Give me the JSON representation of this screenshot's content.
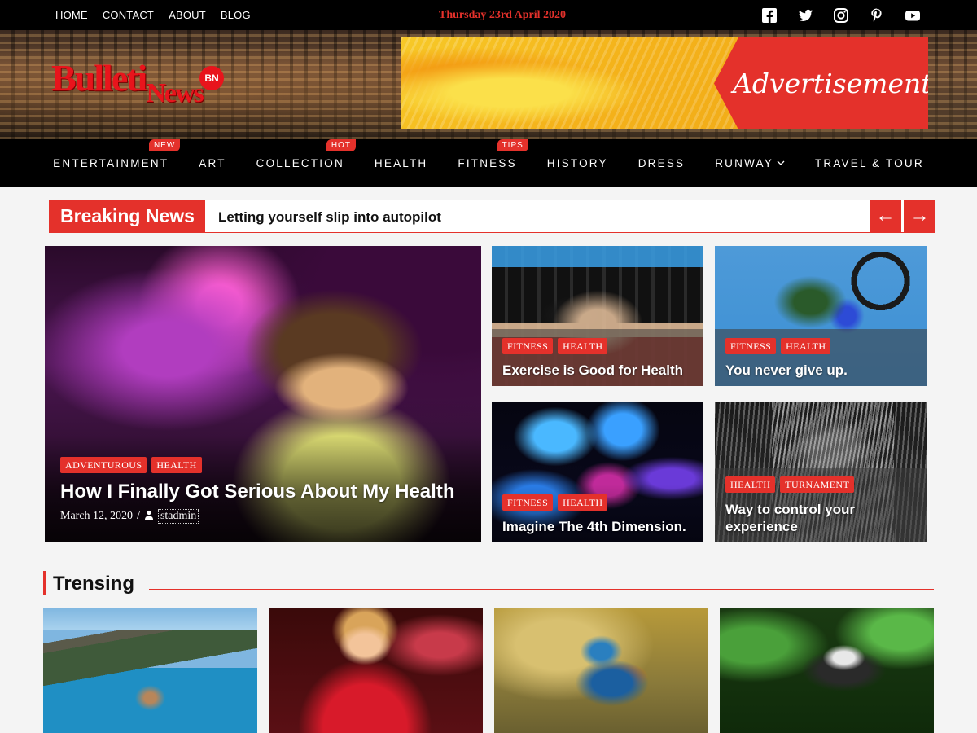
{
  "colors": {
    "accent": "#e4312b",
    "topbar": "#000000"
  },
  "topbar": {
    "links": [
      "HOME",
      "CONTACT",
      "ABOUT",
      "BLOG"
    ],
    "date": "Thursday 23rd April 2020",
    "socials": [
      "facebook-icon",
      "twitter-icon",
      "instagram-icon",
      "pinterest-icon",
      "youtube-icon"
    ]
  },
  "header": {
    "logo": {
      "word1": "Bulleti",
      "word2": "News",
      "badge": "BN"
    },
    "ad_text": "Advertisement"
  },
  "nav": {
    "items": [
      {
        "label": "ENTERTAINMENT",
        "badge": "NEW"
      },
      {
        "label": "ART"
      },
      {
        "label": "COLLECTION",
        "badge": "HOT"
      },
      {
        "label": "HEALTH"
      },
      {
        "label": "FITNESS",
        "badge": "TIPS"
      },
      {
        "label": "HISTORY"
      },
      {
        "label": "DRESS"
      },
      {
        "label": "RUNWAY",
        "dropdown": true
      },
      {
        "label": "TRAVEL & TOUR"
      }
    ]
  },
  "breaking": {
    "label": "Breaking News",
    "headline": "Letting yourself slip into autopilot",
    "prev": "←",
    "next": "→"
  },
  "featured": {
    "main": {
      "tags": [
        "ADVENTUROUS",
        "HEALTH"
      ],
      "title": "How I Finally Got Serious About My Health",
      "date": "March 12, 2020",
      "sep": "/",
      "author": "stadmin"
    },
    "cards": [
      {
        "tags": [
          "FITNESS",
          "HEALTH"
        ],
        "title": "Exercise is Good for Health"
      },
      {
        "tags": [
          "FITNESS",
          "HEALTH"
        ],
        "title": "You never give up."
      },
      {
        "tags": [
          "FITNESS",
          "HEALTH"
        ],
        "title": "Imagine The 4th Dimension."
      },
      {
        "tags": [
          "HEALTH",
          "TURNAMENT"
        ],
        "title": "Way to control your experience"
      }
    ]
  },
  "trending": {
    "title": "Trensing"
  }
}
